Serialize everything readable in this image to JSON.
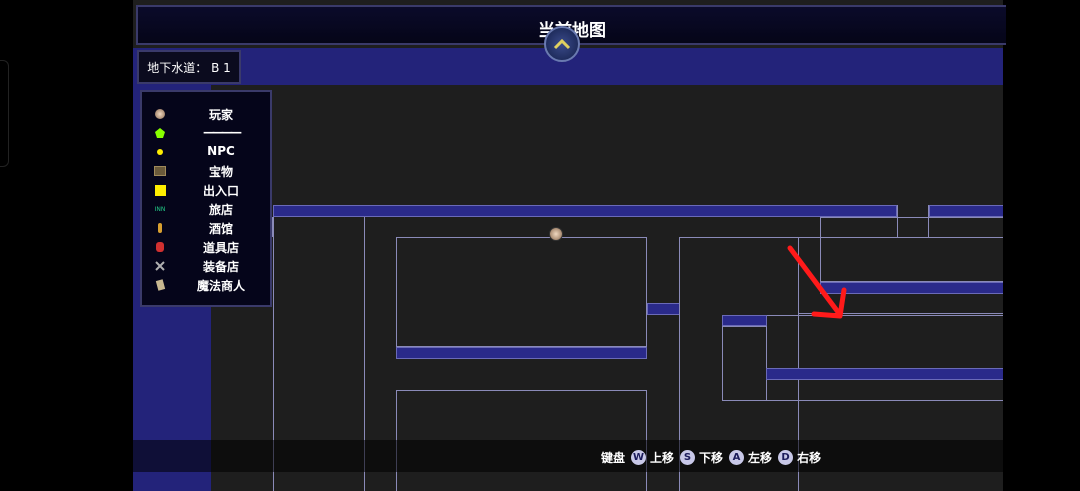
{
  "header": {
    "title": "当前地图"
  },
  "area": {
    "label": "地下水道： B 1"
  },
  "legend": {
    "items": [
      {
        "label": "玩家",
        "icon": "player-face-icon"
      },
      {
        "label": "————",
        "icon": "green-pentagon-icon",
        "color": "#88ff00"
      },
      {
        "label": "NPC",
        "icon": "npc-dot-icon",
        "color": "#ffee00"
      },
      {
        "label": "宝物",
        "icon": "treasure-icon"
      },
      {
        "label": "出入口",
        "icon": "exit-square-icon",
        "color": "#ffee00"
      },
      {
        "label": "旅店",
        "icon": "inn-sign-icon",
        "icon_text": "INN",
        "color": "#22cc88"
      },
      {
        "label": "酒馆",
        "icon": "tavern-icon"
      },
      {
        "label": "道具店",
        "icon": "item-shop-icon"
      },
      {
        "label": "装备店",
        "icon": "equipment-shop-icon"
      },
      {
        "label": "魔法商人",
        "icon": "magic-merchant-icon"
      }
    ]
  },
  "controls": {
    "keyboard_label": "键盘",
    "keys": [
      {
        "key": "W",
        "action": "上移"
      },
      {
        "key": "S",
        "action": "下移"
      },
      {
        "key": "A",
        "action": "左移"
      },
      {
        "key": "D",
        "action": "右移"
      }
    ]
  },
  "colors": {
    "accent": "#23237a",
    "arrow": "#ff1a1a"
  }
}
